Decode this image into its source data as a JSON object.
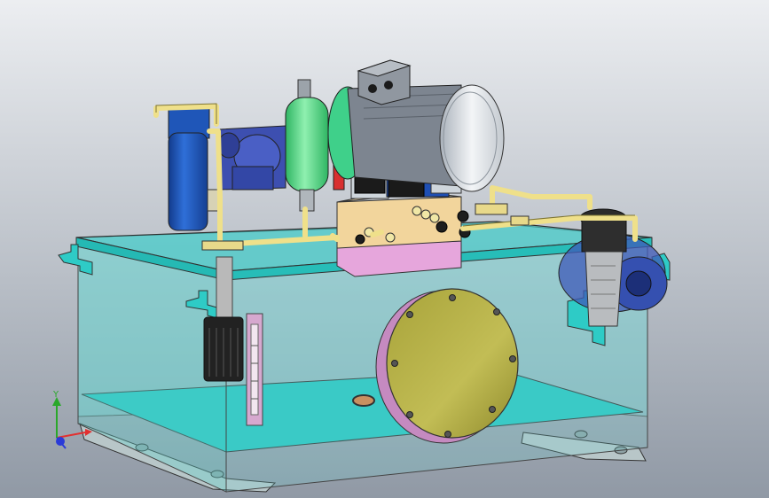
{
  "viewport": {
    "background_top": "#e6e9ed",
    "background_bottom": "#9aa3ae"
  },
  "model": {
    "parts": [
      "hydraulic-tank",
      "electric-motor",
      "pump",
      "return-filter",
      "accumulator",
      "valve-manifold",
      "directional-valves",
      "pressure-gauge",
      "breather-filter",
      "level-gauge",
      "suction-strainer",
      "cleanout-cover",
      "piping",
      "mounting-feet"
    ],
    "colors": {
      "tank_glass": "#5fd3cf",
      "tank_floor": "#2cc7c2",
      "pipe": "#efe08a",
      "motor_body": "#7d8590",
      "motor_fan_cover": "#e7ebef",
      "motor_flange": "#3fd08a",
      "pump_blue": "#3d4fb0",
      "filter_blue": "#1f56b8",
      "accumulator_green": "#5fe08c",
      "valve_blue": "#1e4fb5",
      "manifold": "#f2d59c",
      "manifold_base": "#e6a6dc",
      "cover_plate": "#b7b24a",
      "red_gauge": "#d83030"
    }
  },
  "triad": {
    "y_label": "Y",
    "x_color": "#e23030",
    "y_color": "#2aa82a",
    "z_color": "#2a3ad8"
  }
}
